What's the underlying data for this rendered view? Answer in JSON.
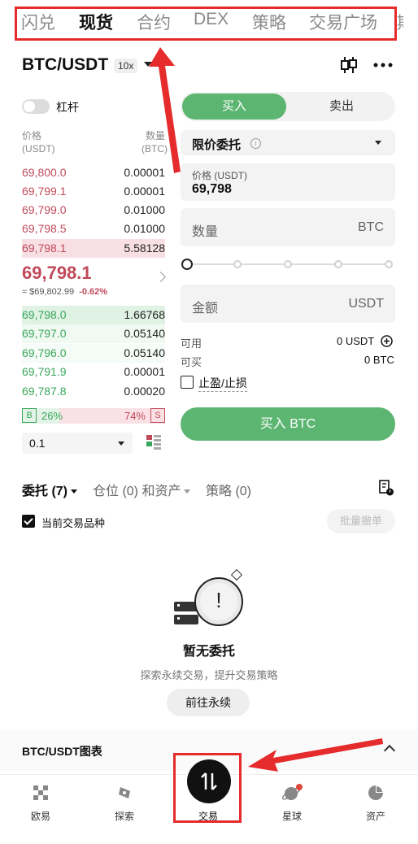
{
  "top_tabs": [
    "闪兑",
    "现货",
    "合约",
    "DEX",
    "策略",
    "交易广场",
    "期"
  ],
  "active_top_tab": "现货",
  "pair": "BTC/USDT",
  "leverage_badge": "10x",
  "leverage_label": "杠杆",
  "orderbook": {
    "price_header": "价格",
    "price_unit": "(USDT)",
    "qty_header": "数量",
    "qty_unit": "(BTC)",
    "asks": [
      {
        "price": "69,800.0",
        "qty": "0.00001"
      },
      {
        "price": "69,799.1",
        "qty": "0.00001"
      },
      {
        "price": "69,799.0",
        "qty": "0.01000"
      },
      {
        "price": "69,798.5",
        "qty": "0.01000"
      },
      {
        "price": "69,798.1",
        "qty": "5.58128"
      }
    ],
    "last_price": "69,798.1",
    "ref_price": "≈ $69,802.99",
    "change": "-0.62%",
    "bids": [
      {
        "price": "69,798.0",
        "qty": "1.66768"
      },
      {
        "price": "69,797.0",
        "qty": "0.05140"
      },
      {
        "price": "69,796.0",
        "qty": "0.05140"
      },
      {
        "price": "69,791.9",
        "qty": "0.00001"
      },
      {
        "price": "69,787.8",
        "qty": "0.00020"
      }
    ],
    "buy_ratio": "26%",
    "sell_ratio": "74%",
    "buy_ratio_value": 26,
    "badge_b": "B",
    "badge_s": "S",
    "precision": "0.1"
  },
  "form": {
    "buy_tab": "买入",
    "sell_tab": "卖出",
    "order_type": "限价委托",
    "info_glyph": "i",
    "price_label": "价格 (USDT)",
    "price_value": "69,798",
    "qty_placeholder": "数量",
    "qty_unit": "BTC",
    "amount_placeholder": "金额",
    "amount_unit": "USDT",
    "available_label": "可用",
    "available_value": "0 USDT",
    "buyable_label": "可买",
    "buyable_value": "0 BTC",
    "tpsl_label": "止盈/止损",
    "buy_button": "买入 BTC"
  },
  "orders": {
    "tabs": [
      "委托 (7)",
      "仓位 (0) 和资产",
      "策略 (0)"
    ],
    "current_pair_label": "当前交易品种",
    "batch_cancel": "批量撤单",
    "empty_glyph": "!",
    "empty_title": "暂无委托",
    "empty_sub": "探索永续交易，提升交易策略",
    "goto_button": "前往永续"
  },
  "chart_bar_label": "BTC/USDT图表",
  "bottom_nav": [
    "欧易",
    "探索",
    "交易",
    "星球",
    "资产"
  ],
  "colors": {
    "ask": "#c04a5a",
    "bid": "#3aa65b",
    "buy_button": "#5cb571",
    "highlight": "#e52b2b"
  }
}
